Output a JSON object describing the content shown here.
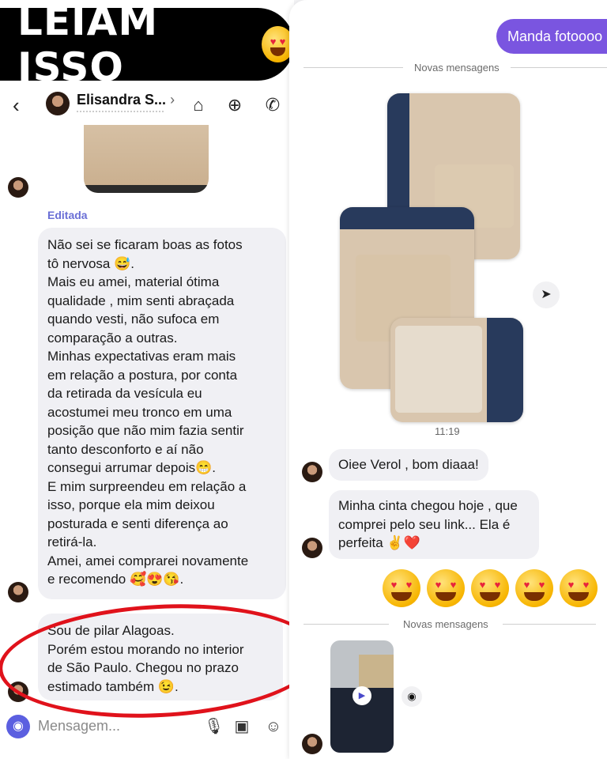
{
  "banner": {
    "text": "LEIAM ISSO",
    "emoji": "heart-eyes-emoji"
  },
  "contact": {
    "name": "Elisandra S...",
    "chevron": "›"
  },
  "left_chat": {
    "edited_label": "Editada",
    "review_lines": [
      "Não sei se ficaram boas as fotos",
      "tô nervosa 😅.",
      "Mais eu amei, material ótima",
      "qualidade , mim senti abraçada",
      "quando vesti, não sufoca em",
      "comparação a outras.",
      "Minhas expectativas eram mais",
      "em relação a postura, por conta",
      "da retirada da vesícula eu",
      "acostumei meu tronco em uma",
      "posição que não mim fazia sentir",
      "tanto desconforto e aí não",
      "consegui arrumar depois😁.",
      "E mim surpreendeu em relação a",
      "isso, porque ela mim deixou",
      "posturada e senti diferença ao",
      "retirá-la.",
      "Amei, amei comprarei novamente",
      "e recomendo 🥰😍😘."
    ],
    "location_lines": [
      "Sou de pilar Alagoas.",
      "Porém estou morando no interior",
      "de São Paulo.  Chegou no prazo",
      "estimado também 😉."
    ]
  },
  "composer": {
    "placeholder": "Mensagem..."
  },
  "right_chat": {
    "sent_message": "Manda fotoooo",
    "separator_1": "Novas mensagens",
    "photo_time": "11:19",
    "msg_greeting": "Oiee Verol , bom diaaa!",
    "msg_cinta_lines": [
      "Minha cinta chegou hoje , que",
      "comprei pelo seu link... Ela é",
      "perfeita ✌️❤️"
    ],
    "big_emoji_count": 5,
    "separator_2": "Novas mensagens"
  },
  "colors": {
    "accent": "#7a55e0",
    "edited": "#6a6fd6",
    "highlight_ellipse": "#e0121b",
    "bubble": "#f0f0f4"
  }
}
